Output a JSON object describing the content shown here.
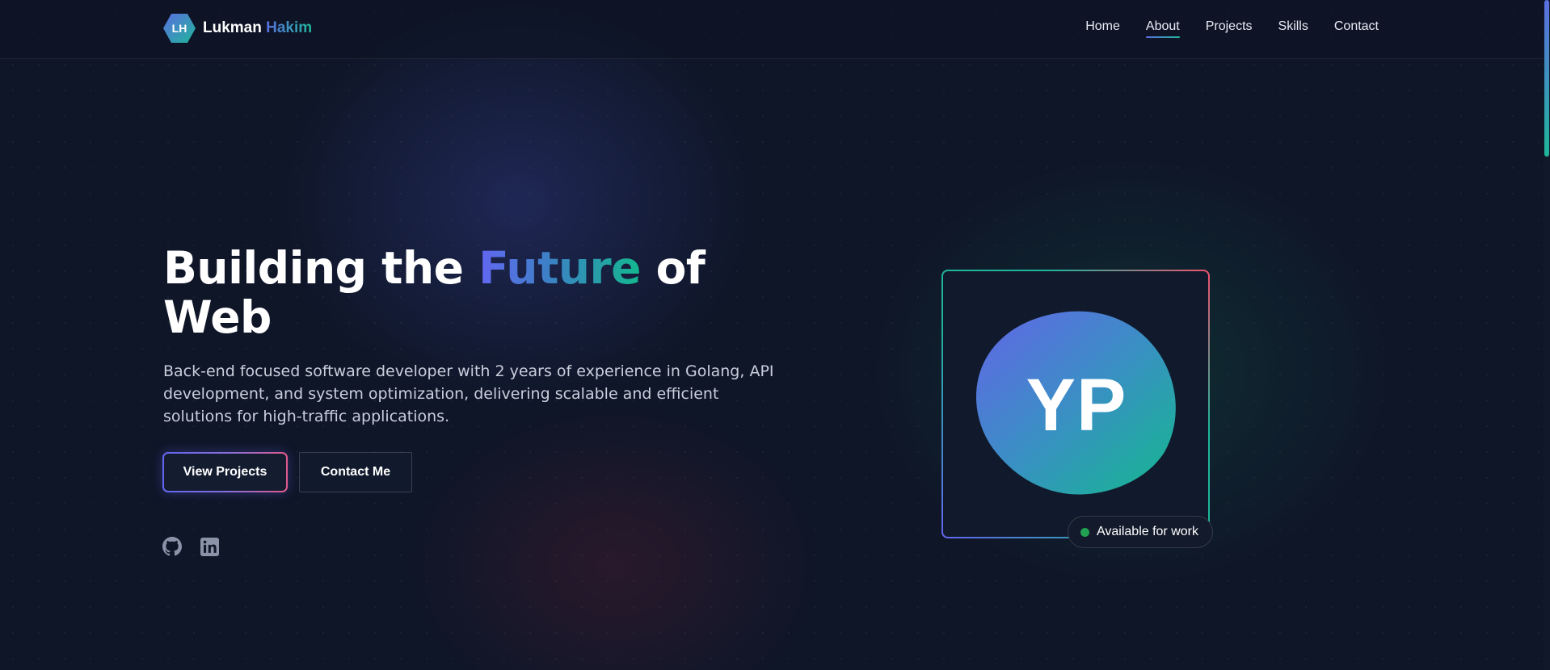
{
  "brand": {
    "initials": "LH",
    "first_name": "Lukman",
    "last_name": "Hakim"
  },
  "nav": {
    "items": [
      {
        "label": "Home"
      },
      {
        "label": "About"
      },
      {
        "label": "Projects"
      },
      {
        "label": "Skills"
      },
      {
        "label": "Contact"
      }
    ],
    "active": "About"
  },
  "hero": {
    "title_part1": "Building the ",
    "title_accent": "Future",
    "title_part2": " of Web",
    "description": "Back-end focused software developer with 2 years of experience in Golang, API development, and system optimization, delivering scalable and efficient solutions for high-traffic applications.",
    "primary_button": "View Projects",
    "secondary_button": "Contact Me"
  },
  "social": {
    "icons": [
      "github-icon",
      "linkedin-icon"
    ]
  },
  "avatar": {
    "initials": "YP"
  },
  "badge": {
    "text": "Available for work"
  },
  "colors": {
    "background": "#0f1628",
    "accent_start": "#6366f1",
    "accent_end": "#14b88f",
    "status_green": "#22a153"
  }
}
